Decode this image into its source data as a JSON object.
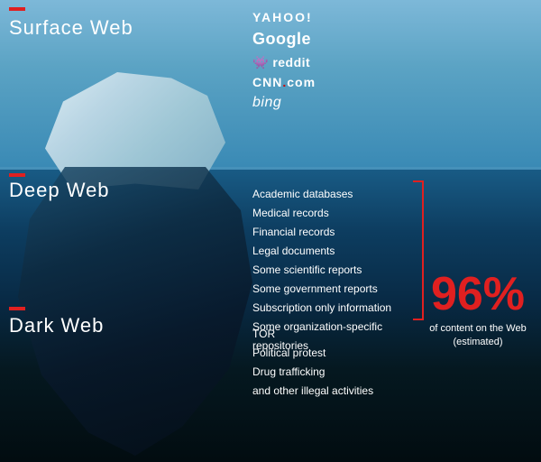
{
  "sections": {
    "surface": {
      "label": "Surface Web",
      "logos": [
        "YAHOO!",
        "Google",
        "✦ reddit",
        "CNN.com",
        "bing"
      ]
    },
    "deep": {
      "label": "Deep Web",
      "items": [
        "Academic databases",
        "Medical records",
        "Financial records",
        "Legal documents",
        "Some scientific reports",
        "Some government reports",
        "Subscription only information",
        "Some organization-specific",
        "repositories"
      ]
    },
    "dark": {
      "label": "Dark Web",
      "items": [
        "TOR",
        "Political protest",
        "Drug trafficking",
        "and other illegal activities"
      ]
    }
  },
  "stat": {
    "percent": "96%",
    "label": "of content on the Web (estimated)"
  },
  "accents": {
    "color": "#e02020"
  }
}
